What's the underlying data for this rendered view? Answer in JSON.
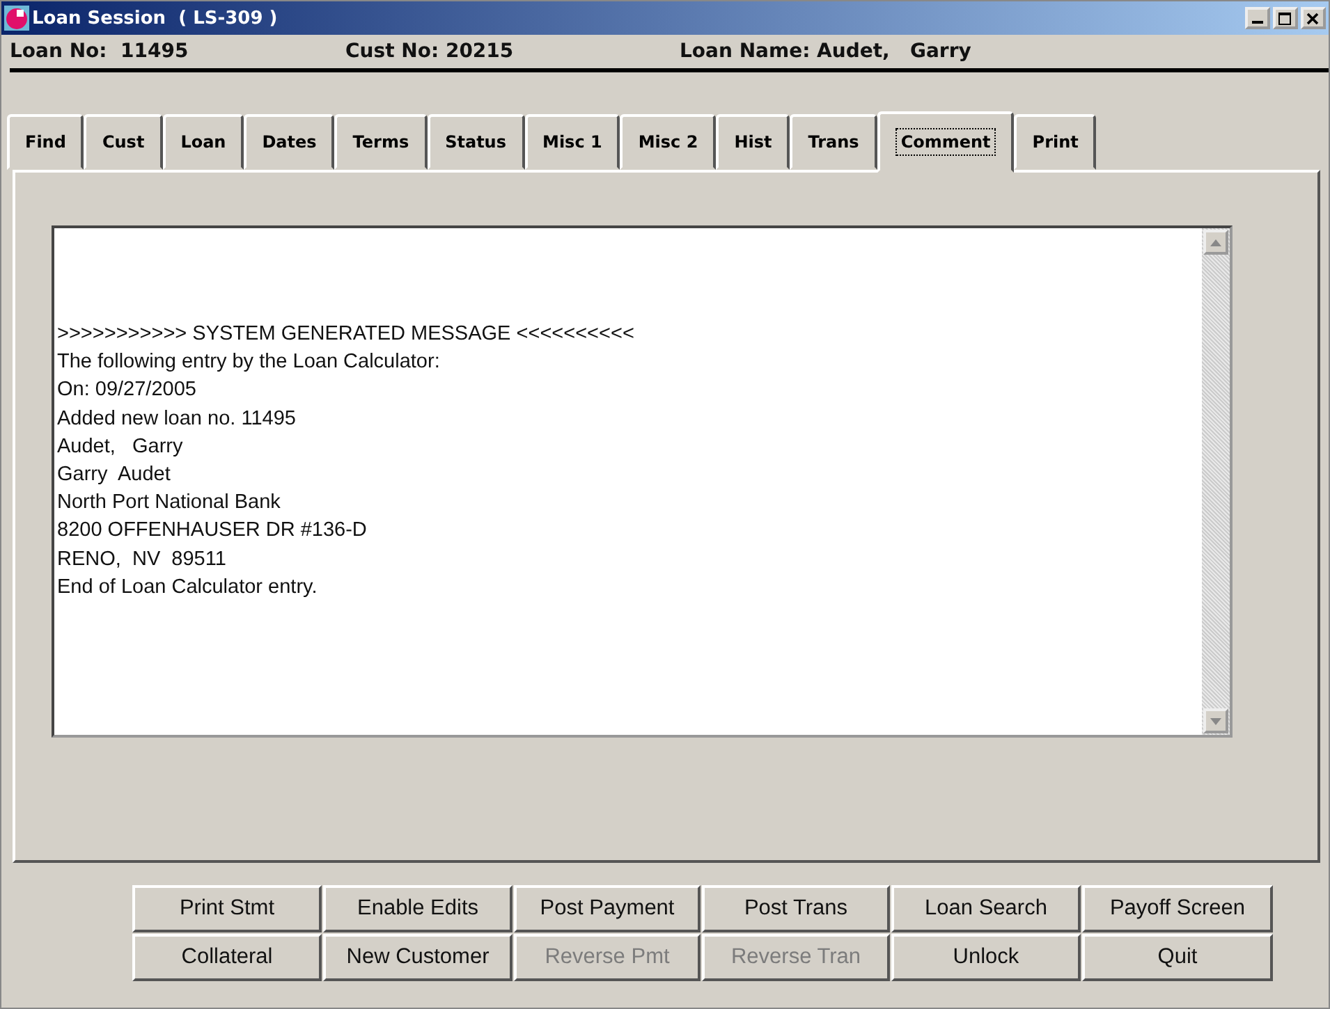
{
  "window": {
    "title": "Loan Session  ( LS-309 )"
  },
  "header": {
    "loan_no": "Loan No:  11495",
    "cust_no": "Cust No: 20215",
    "loan_name": "Loan Name: Audet,   Garry"
  },
  "tabs": [
    {
      "label": "Find",
      "selected": false
    },
    {
      "label": "Cust",
      "selected": false
    },
    {
      "label": "Loan",
      "selected": false
    },
    {
      "label": "Dates",
      "selected": false
    },
    {
      "label": "Terms",
      "selected": false
    },
    {
      "label": "Status",
      "selected": false
    },
    {
      "label": "Misc 1",
      "selected": false
    },
    {
      "label": "Misc 2",
      "selected": false
    },
    {
      "label": "Hist",
      "selected": false
    },
    {
      "label": "Trans",
      "selected": false
    },
    {
      "label": "Comment",
      "selected": true
    },
    {
      "label": "Print",
      "selected": false
    }
  ],
  "comment_lines": [
    ">>>>>>>>>>> SYSTEM GENERATED MESSAGE <<<<<<<<<<",
    "The following entry by the Loan Calculator:",
    "On: 09/27/2005",
    "Added new loan no. 11495",
    "Audet,   Garry",
    "Garry  Audet",
    "North Port National Bank",
    "8200 OFFENHAUSER DR #136-D",
    "RENO,  NV  89511",
    "End of Loan Calculator entry."
  ],
  "buttons": [
    {
      "label": "Print Stmt",
      "disabled": false
    },
    {
      "label": "Enable Edits",
      "disabled": false
    },
    {
      "label": "Post Payment",
      "disabled": false
    },
    {
      "label": "Post Trans",
      "disabled": false
    },
    {
      "label": "Loan Search",
      "disabled": false
    },
    {
      "label": "Payoff Screen",
      "disabled": false
    },
    {
      "label": "Collateral",
      "disabled": false
    },
    {
      "label": "New Customer",
      "disabled": false
    },
    {
      "label": "Reverse Pmt",
      "disabled": true
    },
    {
      "label": "Reverse Tran",
      "disabled": true
    },
    {
      "label": "Unlock",
      "disabled": false
    },
    {
      "label": "Quit",
      "disabled": false
    }
  ]
}
